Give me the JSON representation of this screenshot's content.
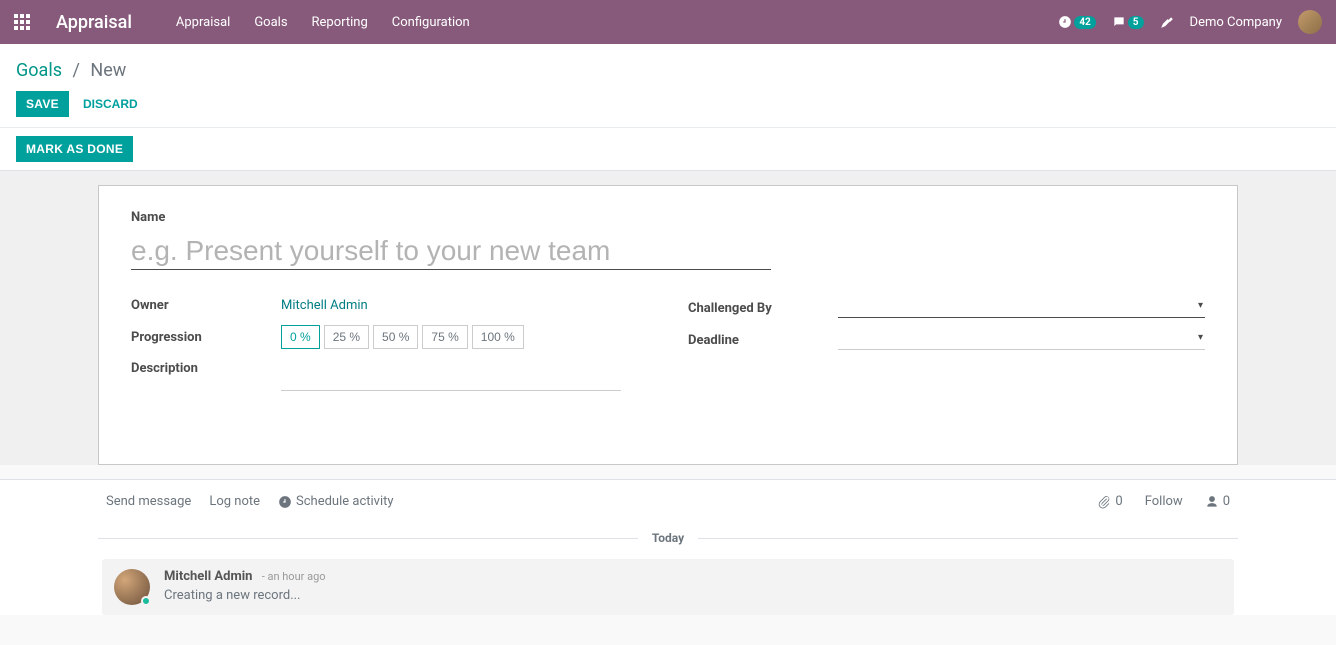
{
  "navbar": {
    "brand": "Appraisal",
    "menu": [
      "Appraisal",
      "Goals",
      "Reporting",
      "Configuration"
    ],
    "clock_badge": "42",
    "chat_badge": "5",
    "company": "Demo Company"
  },
  "breadcrumb": {
    "root": "Goals",
    "current": "New"
  },
  "buttons": {
    "save": "SAVE",
    "discard": "DISCARD",
    "mark_done": "MARK AS DONE"
  },
  "form": {
    "name_label": "Name",
    "name_placeholder": "e.g. Present yourself to your new team",
    "name_value": "",
    "owner_label": "Owner",
    "owner_value": "Mitchell Admin",
    "progression_label": "Progression",
    "progression_options": [
      "0 %",
      "25 %",
      "50 %",
      "75 %",
      "100 %"
    ],
    "progression_selected": "0 %",
    "description_label": "Description",
    "challenged_label": "Challenged By",
    "challenged_value": "",
    "deadline_label": "Deadline",
    "deadline_value": ""
  },
  "chatter": {
    "send_message": "Send message",
    "log_note": "Log note",
    "schedule_activity": "Schedule activity",
    "attach_count": "0",
    "follow_label": "Follow",
    "follower_count": "0",
    "separator": "Today",
    "message": {
      "author": "Mitchell Admin",
      "time": "- an hour ago",
      "body": "Creating a new record..."
    }
  }
}
